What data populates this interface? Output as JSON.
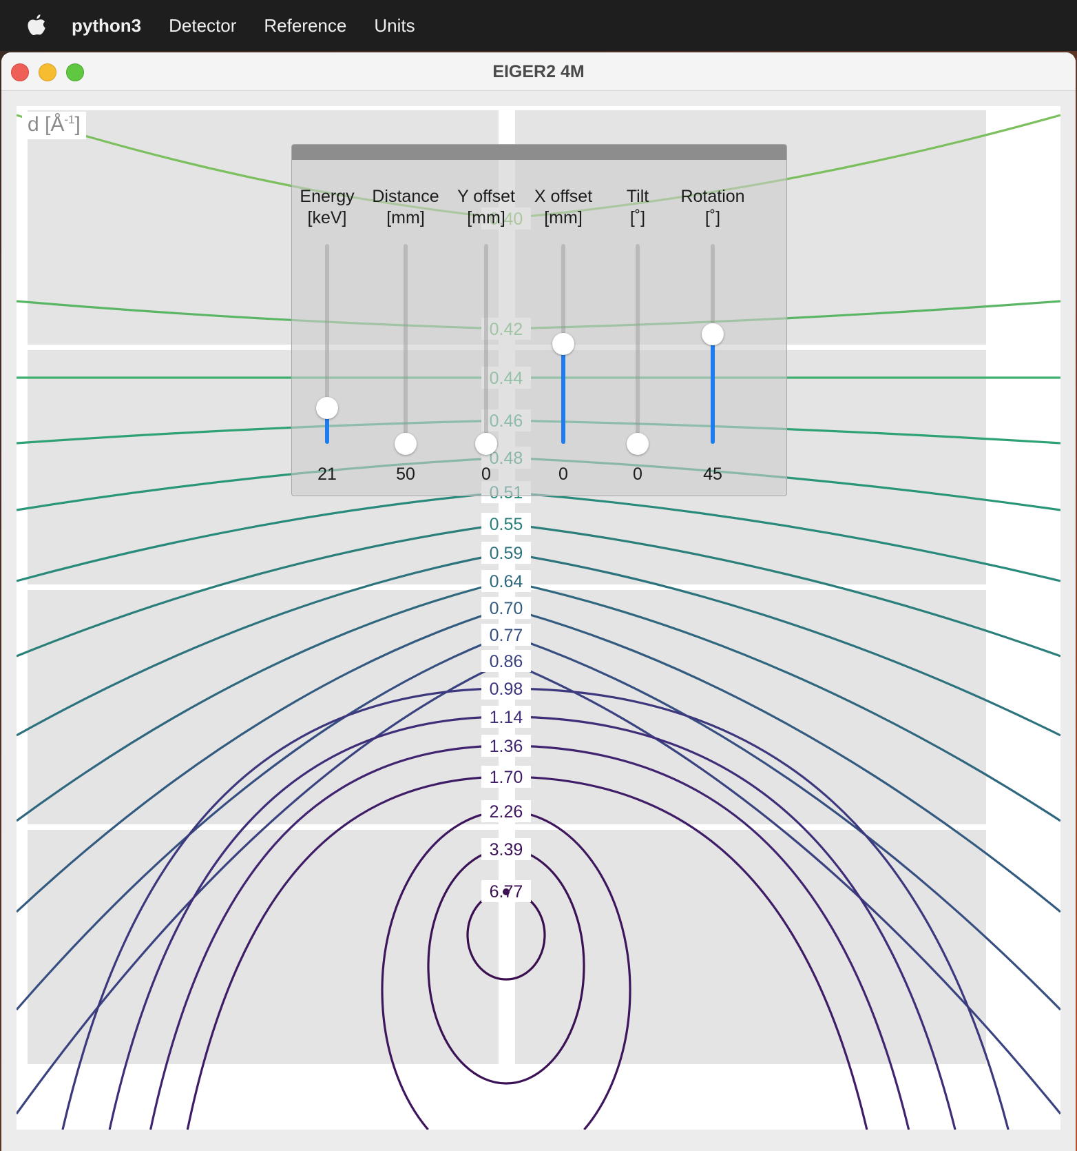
{
  "menubar": {
    "app_name": "python3",
    "items": [
      "Detector",
      "Reference",
      "Units"
    ]
  },
  "window": {
    "title": "EIGER2 4M"
  },
  "plot": {
    "ylabel_main": "d [Å",
    "ylabel_sup": "-1",
    "ylabel_tail": "]",
    "contour_labels": [
      "0.40",
      "0.42",
      "0.44",
      "0.46",
      "0.48",
      "0.51",
      "0.55",
      "0.59",
      "0.64",
      "0.70",
      "0.77",
      "0.86",
      "0.98",
      "1.14",
      "1.36",
      "1.70",
      "2.26",
      "3.39",
      "6.77"
    ]
  },
  "panel": {
    "sliders": [
      {
        "line1": "Energy",
        "line2": "[keV]",
        "value": "21",
        "fraction": 0.18
      },
      {
        "line1": "Distance",
        "line2": "[mm]",
        "value": "50",
        "fraction": 0.0
      },
      {
        "line1": "Y offset",
        "line2": "[mm]",
        "value": "0",
        "fraction": 0.0
      },
      {
        "line1": "X offset",
        "line2": "[mm]",
        "value": "0",
        "fraction": 0.5
      },
      {
        "line1": "Tilt",
        "line2": "[˚]",
        "value": "0",
        "fraction": 0.0
      },
      {
        "line1": "Rotation",
        "line2": "[˚]",
        "value": "45",
        "fraction": 0.55
      }
    ]
  }
}
